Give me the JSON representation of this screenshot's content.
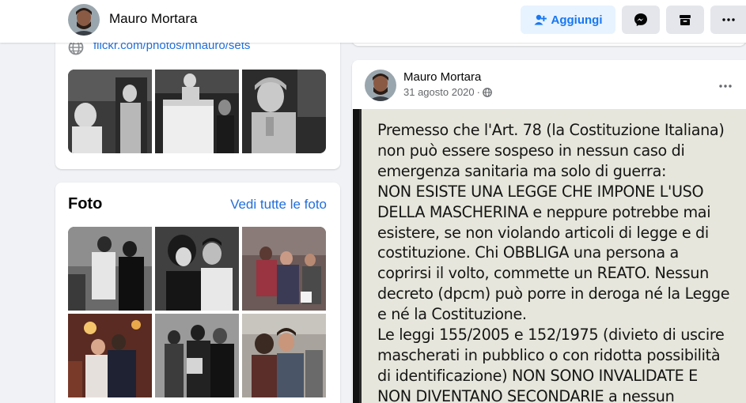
{
  "header": {
    "profile_name": "Mauro Mortara",
    "add_button_label": "Aggiungi",
    "icons": [
      "user-plus-icon",
      "messenger-icon",
      "archive-icon",
      "more-icon"
    ]
  },
  "intro": {
    "link_text": "flickr.com/photos/mnauro/sets",
    "link_icon": "globe-icon",
    "photos": [
      {
        "desc": "bw-performer-portrait"
      },
      {
        "desc": "bw-statue-mime"
      },
      {
        "desc": "bw-silver-mime"
      }
    ]
  },
  "photos": {
    "title": "Foto",
    "see_all_label": "Vedi tutte le foto",
    "items": [
      {
        "desc": "bw-tango-couple"
      },
      {
        "desc": "bw-tango-embrace"
      },
      {
        "desc": "color-milonga-dance"
      },
      {
        "desc": "color-tango-couple-red"
      },
      {
        "desc": "bw-tango-group"
      },
      {
        "desc": "color-tango-closeup"
      }
    ]
  },
  "post": {
    "author": "Mauro Mortara",
    "date": "31 agosto 2020",
    "audience_icon": "globe-icon",
    "image_text_lines": [
      "Premesso che l'Art. 78 (la Costituzione Italiana)",
      "non può  essere sospeso in nessun caso di",
      "emergenza sanitaria ma solo di guerra:",
      "NON ESISTE UNA LEGGE CHE IMPONE L'USO",
      "DELLA MASCHERINA e neppure potrebbe mai",
      "esistere, se non violando articoli di legge e di",
      "costituzione. Chi OBBLIGA una persona a",
      "coprirsi il volto, commette un REATO. Nessun",
      "decreto (dpcm) può porre in deroga né la Legge",
      "e né la Costituzione.",
      "Le leggi 155/2005 e 152/1975 (divieto di uscire",
      "mascherati in pubblico o con ridotta possibilità",
      "di identificazione) NON SONO INVALIDATE E",
      "NON DIVENTANO SECONDARIE a nessun"
    ]
  },
  "colors": {
    "link": "#216fdb",
    "accent": "#1877f2",
    "button_light": "#e7f3ff",
    "button_grey": "#e4e6eb",
    "background": "#f0f2f5"
  }
}
